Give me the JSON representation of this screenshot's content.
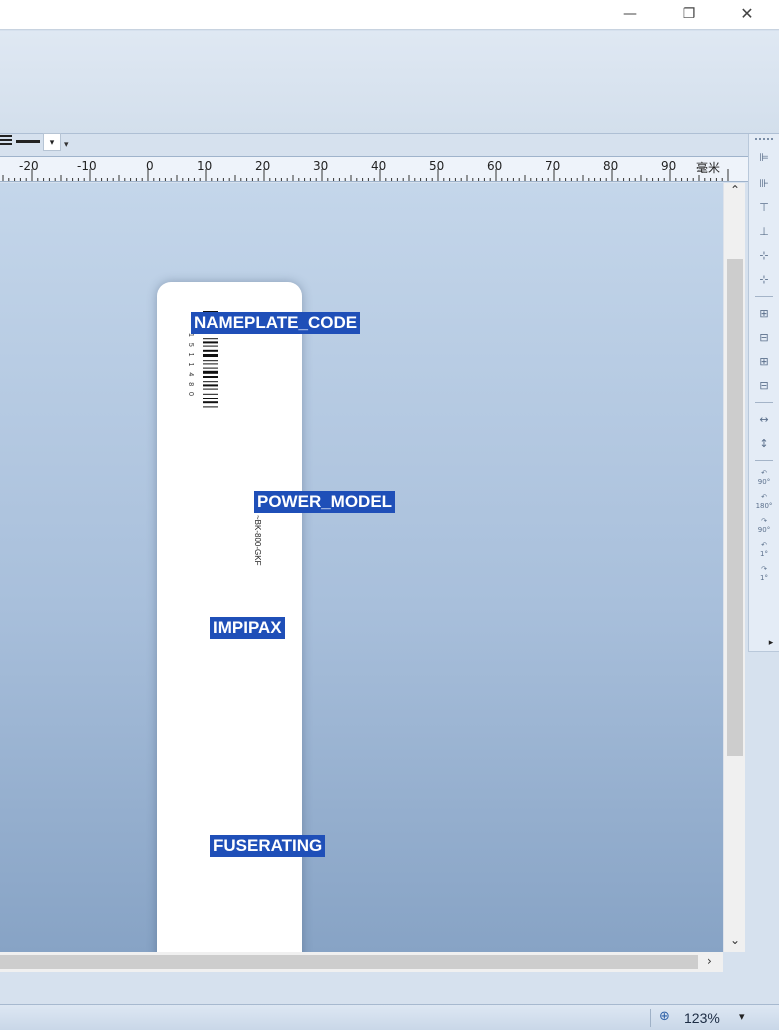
{
  "window": {
    "minimize_glyph": "—",
    "restore_glyph": "❐",
    "close_glyph": "✕"
  },
  "toolbar": {
    "line_style_drop_glyph": "▾",
    "overflow_glyph": "▾"
  },
  "ruler": {
    "unit": "毫米",
    "labels": [
      "-20",
      "-10",
      "0",
      "10",
      "20",
      "30",
      "40",
      "50",
      "60",
      "70",
      "80",
      "90"
    ]
  },
  "right_toolbar": {
    "rotate_labels": [
      "90°",
      "180°",
      "90°",
      "1°",
      "1°"
    ],
    "end_glyph": "▸"
  },
  "label_card": {
    "fields": [
      "NAMEPLATE_CODE",
      "POWER_MODEL",
      "IMPIPAX",
      "FUSERATING"
    ],
    "barcode_digits": "1 5 1 1 4 8 0",
    "model_text": "~BK-800-GKF"
  },
  "scrollbars": {
    "up": "⌃",
    "down": "⌄",
    "right": "›"
  },
  "status": {
    "zoom": "123%",
    "zoom_icon_glyph": "⊕",
    "zoom_drop_glyph": "▾"
  },
  "colors": {
    "field_highlight": "#1f4fb8",
    "canvas_top": "#c4d6ea",
    "canvas_bottom": "#87a3c5"
  }
}
